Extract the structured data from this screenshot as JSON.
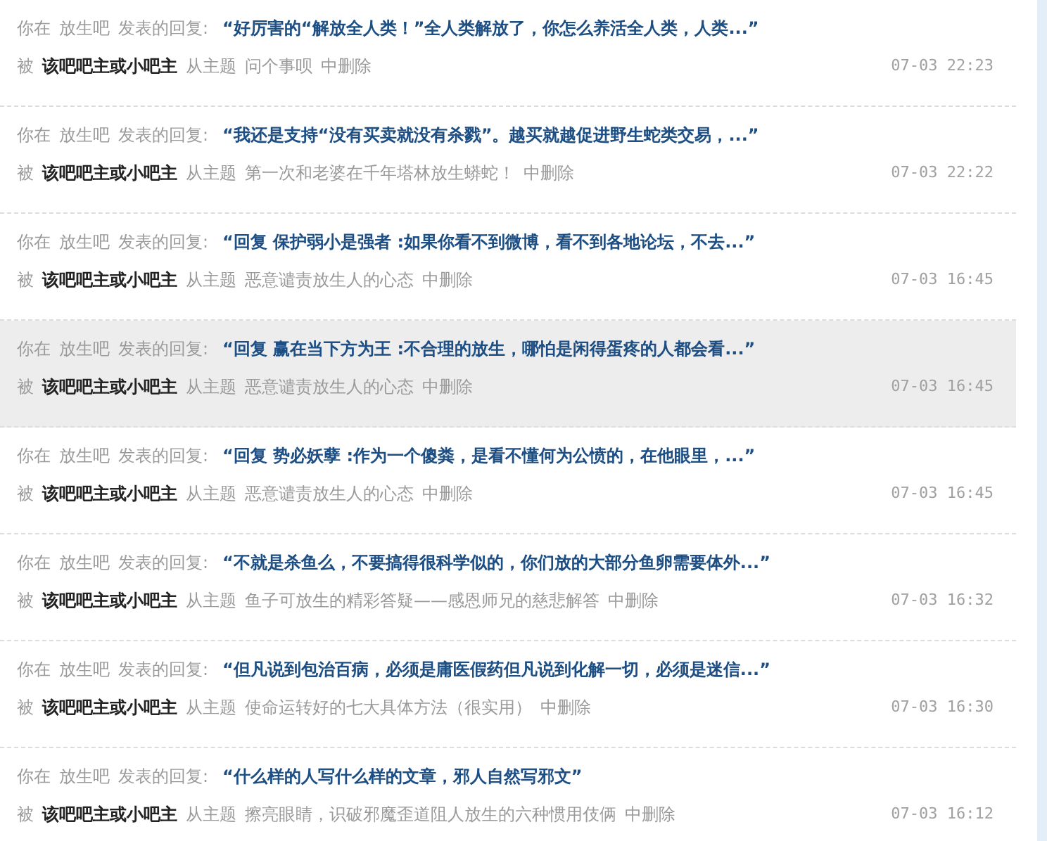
{
  "replies": [
    {
      "prefix": "你在",
      "forum": "放生吧",
      "action": "发表的回复:",
      "quote": "“好厉害的“解放全人类！”全人类解放了，你怎么养活全人类，人类...”",
      "by": "被",
      "deleter": "该吧吧主或小吧主",
      "from": "从主题",
      "topic": "问个事呗",
      "suffix": "中删除",
      "time": "07-03 22:23",
      "highlighted": false
    },
    {
      "prefix": "你在",
      "forum": "放生吧",
      "action": "发表的回复:",
      "quote": "“我还是支持“没有买卖就没有杀戮”。越买就越促进野生蛇类交易，...”",
      "by": "被",
      "deleter": "该吧吧主或小吧主",
      "from": "从主题",
      "topic": "第一次和老婆在千年塔林放生蟒蛇！",
      "suffix": "中删除",
      "time": "07-03 22:22",
      "highlighted": false
    },
    {
      "prefix": "你在",
      "forum": "放生吧",
      "action": "发表的回复:",
      "quote": "“回复 保护弱小是强者 :如果你看不到微博，看不到各地论坛，不去...”",
      "by": "被",
      "deleter": "该吧吧主或小吧主",
      "from": "从主题",
      "topic": "恶意谴责放生人的心态",
      "suffix": "中删除",
      "time": "07-03 16:45",
      "highlighted": false
    },
    {
      "prefix": "你在",
      "forum": "放生吧",
      "action": "发表的回复:",
      "quote": "“回复 赢在当下方为王 :不合理的放生，哪怕是闲得蛋疼的人都会看...”",
      "by": "被",
      "deleter": "该吧吧主或小吧主",
      "from": "从主题",
      "topic": "恶意谴责放生人的心态",
      "suffix": "中删除",
      "time": "07-03 16:45",
      "highlighted": true
    },
    {
      "prefix": "你在",
      "forum": "放生吧",
      "action": "发表的回复:",
      "quote": "“回复 势必妖孽 :作为一个傻粪，是看不懂何为公愤的，在他眼里，...”",
      "by": "被",
      "deleter": "该吧吧主或小吧主",
      "from": "从主题",
      "topic": "恶意谴责放生人的心态",
      "suffix": "中删除",
      "time": "07-03 16:45",
      "highlighted": false
    },
    {
      "prefix": "你在",
      "forum": "放生吧",
      "action": "发表的回复:",
      "quote": "“不就是杀鱼么，不要搞得很科学似的，你们放的大部分鱼卵需要体外...”",
      "by": "被",
      "deleter": "该吧吧主或小吧主",
      "from": "从主题",
      "topic": "鱼子可放生的精彩答疑——感恩师兄的慈悲解答",
      "suffix": "中删除",
      "time": "07-03 16:32",
      "highlighted": false
    },
    {
      "prefix": "你在",
      "forum": "放生吧",
      "action": "发表的回复:",
      "quote": "“但凡说到包治百病，必须是庸医假药但凡说到化解一切，必须是迷信...”",
      "by": "被",
      "deleter": "该吧吧主或小吧主",
      "from": "从主题",
      "topic": "使命运转好的七大具体方法（很实用）",
      "suffix": "中删除",
      "time": "07-03 16:30",
      "highlighted": false
    },
    {
      "prefix": "你在",
      "forum": "放生吧",
      "action": "发表的回复:",
      "quote": "“什么样的人写什么样的文章，邪人自然写邪文”",
      "by": "被",
      "deleter": "该吧吧主或小吧主",
      "from": "从主题",
      "topic": "擦亮眼睛，识破邪魔歪道阻人放生的六种惯用伎俩",
      "suffix": "中删除",
      "time": "07-03 16:12",
      "highlighted": false
    }
  ]
}
